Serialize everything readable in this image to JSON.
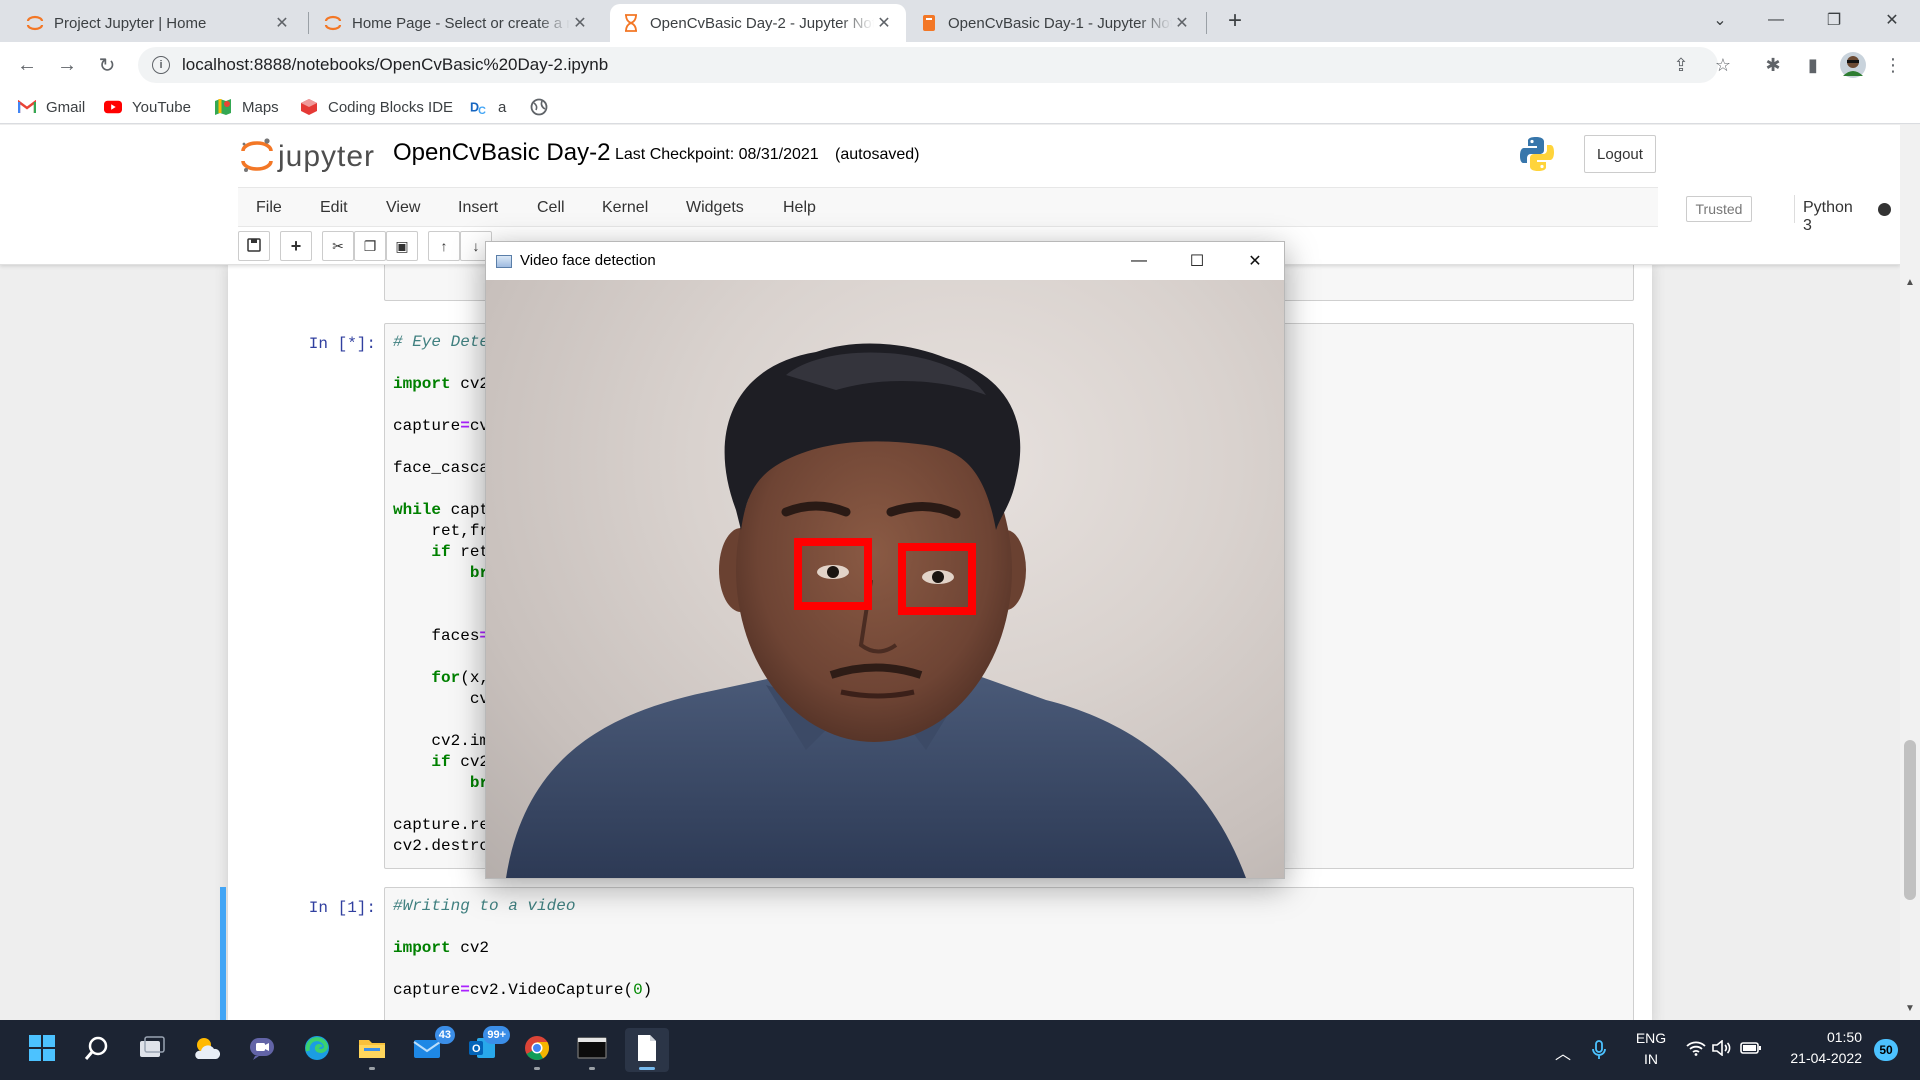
{
  "browser": {
    "tabs": [
      {
        "title": "Project Jupyter | Home",
        "icon": "jupyter-icon"
      },
      {
        "title": "Home Page - Select or create a notebook",
        "icon": "jupyter-icon"
      },
      {
        "title": "OpenCvBasic Day-2 - Jupyter Notebook",
        "icon": "hourglass-icon"
      },
      {
        "title": "OpenCvBasic Day-1 - Jupyter Notebook",
        "icon": "notebook-icon"
      }
    ],
    "url": "localhost:8888/notebooks/OpenCvBasic%20Day-2.ipynb",
    "bookmarks": [
      {
        "label": "Gmail",
        "icon": "gmail-icon"
      },
      {
        "label": "YouTube",
        "icon": "youtube-icon"
      },
      {
        "label": "Maps",
        "icon": "maps-icon"
      },
      {
        "label": "Coding Blocks IDE",
        "icon": "coding-blocks-icon"
      },
      {
        "label": "a",
        "icon": "dc-icon"
      },
      {
        "label": "",
        "icon": "globe-icon"
      }
    ]
  },
  "jupyter": {
    "logo_text": "jupyter",
    "notebook_name": "OpenCvBasic Day-2",
    "checkpoint": "Last Checkpoint: 08/31/2021",
    "autosave": "(autosaved)",
    "logout_label": "Logout",
    "menu": [
      "File",
      "Edit",
      "View",
      "Insert",
      "Cell",
      "Kernel",
      "Widgets",
      "Help"
    ],
    "trusted_label": "Trusted",
    "kernel_label": "Python 3",
    "cells": [
      {
        "prompt": "In [*]:",
        "lines": [
          {
            "t": "comment",
            "s": "# Eye Dete"
          },
          {
            "t": "blank",
            "s": ""
          },
          {
            "t": "kwline",
            "kw": "import",
            "s": " cv2"
          },
          {
            "t": "blank",
            "s": ""
          },
          {
            "t": "opline",
            "pre": "capture",
            "op": "=",
            "s": "cv"
          },
          {
            "t": "blank",
            "s": ""
          },
          {
            "t": "plain",
            "s": "face_casca"
          },
          {
            "t": "blank",
            "s": ""
          },
          {
            "t": "kwline",
            "kw": "while",
            "s": " capt"
          },
          {
            "t": "plain",
            "s": "    ret,fr"
          },
          {
            "t": "kwline",
            "pre": "    ",
            "kw": "if",
            "s": " ret"
          },
          {
            "t": "kwline",
            "pre": "        ",
            "kw": "br",
            "s": ""
          },
          {
            "t": "blank",
            "s": ""
          },
          {
            "t": "blank",
            "s": ""
          },
          {
            "t": "opline",
            "pre": "    faces",
            "op": "=",
            "s": ""
          },
          {
            "t": "blank",
            "s": ""
          },
          {
            "t": "kwline",
            "pre": "    ",
            "kw": "for",
            "s": "(x,"
          },
          {
            "t": "plain",
            "s": "        cv"
          },
          {
            "t": "blank",
            "s": ""
          },
          {
            "t": "plain",
            "s": "    cv2.im"
          },
          {
            "t": "kwline",
            "pre": "    ",
            "kw": "if",
            "s": " cv2"
          },
          {
            "t": "kwline",
            "pre": "        ",
            "kw": "br",
            "s": ""
          },
          {
            "t": "blank",
            "s": ""
          },
          {
            "t": "plain",
            "s": "capture.re"
          },
          {
            "t": "plain",
            "s": "cv2.destro"
          }
        ]
      },
      {
        "prompt": "In [1]:",
        "lines": [
          {
            "t": "comment",
            "s": "#Writing to a video"
          },
          {
            "t": "blank",
            "s": ""
          },
          {
            "t": "kwline",
            "kw": "import",
            "s": " cv2"
          },
          {
            "t": "blank",
            "s": ""
          },
          {
            "t": "numline",
            "pre": "capture",
            "op": "=",
            "s1": "cv2.VideoCapture(",
            "num": "0",
            "s2": ")"
          }
        ]
      }
    ]
  },
  "cv_window": {
    "title": "Video face detection",
    "detections": 2,
    "box_color": "#ff0000"
  },
  "taskbar": {
    "apps": [
      {
        "icon": "windows-start-icon"
      },
      {
        "icon": "search-icon"
      },
      {
        "icon": "task-view-icon"
      },
      {
        "icon": "weather-icon"
      },
      {
        "icon": "teams-chat-icon"
      },
      {
        "icon": "edge-icon"
      },
      {
        "icon": "file-explorer-icon"
      },
      {
        "icon": "mail-icon",
        "badge": "43"
      },
      {
        "icon": "outlook-icon",
        "badge": "99+"
      },
      {
        "icon": "chrome-icon"
      },
      {
        "icon": "terminal-icon"
      },
      {
        "icon": "file-icon"
      }
    ],
    "lang_top": "ENG",
    "lang_bottom": "IN",
    "time": "01:50",
    "date": "21-04-2022",
    "notification_count": "50"
  }
}
